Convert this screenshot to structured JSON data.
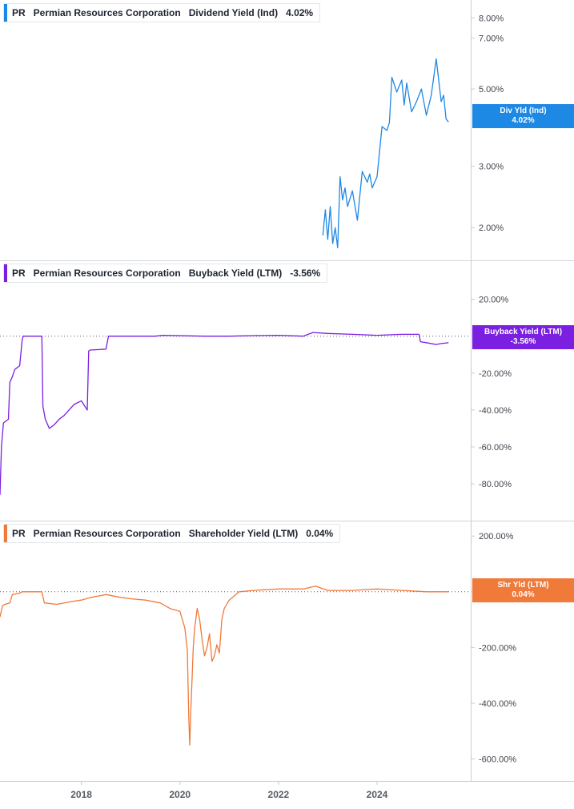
{
  "colors": {
    "dividend": "#1e88e5",
    "buyback": "#7b1fe0",
    "shareholder": "#f07a3a",
    "axis": "#c8ccd2",
    "text": "#40444c"
  },
  "x_axis": {
    "ticks": [
      "2018",
      "2020",
      "2022",
      "2024"
    ]
  },
  "chart_data": [
    {
      "type": "line",
      "ticker": "PR",
      "company": "Permian Resources Corporation",
      "metric": "Dividend Yield (Ind)",
      "current_value": "4.02%",
      "tag": {
        "line1": "Div Yld (Ind)",
        "line2": "4.02%"
      },
      "scale": "log",
      "y_ticks": [
        "8.00%",
        "7.00%",
        "5.00%",
        "3.00%",
        "2.00%"
      ],
      "y_tick_values": [
        8,
        7,
        5,
        3,
        2
      ],
      "series": [
        {
          "x": [
            2022.9,
            2022.95,
            2023.0,
            2023.05,
            2023.1,
            2023.15,
            2023.2,
            2023.25,
            2023.3,
            2023.35,
            2023.4,
            2023.5,
            2023.6,
            2023.7,
            2023.8,
            2023.85,
            2023.9,
            2024.0,
            2024.1,
            2024.2,
            2024.25,
            2024.3,
            2024.4,
            2024.5,
            2024.55,
            2024.6,
            2024.7,
            2024.8,
            2024.9,
            2025.0,
            2025.1,
            2025.2,
            2025.3,
            2025.35,
            2025.4,
            2025.45
          ],
          "y": [
            1.9,
            2.25,
            1.85,
            2.3,
            1.8,
            2.0,
            1.75,
            2.8,
            2.4,
            2.6,
            2.3,
            2.55,
            2.1,
            2.9,
            2.7,
            2.85,
            2.6,
            2.8,
            3.9,
            3.8,
            4.0,
            5.4,
            4.9,
            5.3,
            4.5,
            5.2,
            4.3,
            4.6,
            5.0,
            4.2,
            4.8,
            6.1,
            4.6,
            4.8,
            4.1,
            4.02
          ]
        }
      ]
    },
    {
      "type": "line",
      "ticker": "PR",
      "company": "Permian Resources Corporation",
      "metric": "Buyback Yield (LTM)",
      "current_value": "-3.56%",
      "tag": {
        "line1": "Buyback Yield (LTM)",
        "line2": "-3.56%"
      },
      "y_ticks": [
        "20.00%",
        "-20.00%",
        "-40.00%",
        "-60.00%",
        "-80.00%"
      ],
      "y_tick_values": [
        20,
        -20,
        -40,
        -60,
        -80
      ],
      "ylim": [
        -93,
        32
      ],
      "reference_line": 0,
      "series": [
        {
          "x": [
            2016.35,
            2016.38,
            2016.42,
            2016.52,
            2016.55,
            2016.6,
            2016.65,
            2016.75,
            2016.8,
            2016.82,
            2017.2,
            2017.22,
            2017.27,
            2017.35,
            2017.45,
            2017.55,
            2017.65,
            2017.75,
            2017.85,
            2018.0,
            2018.12,
            2018.15,
            2018.18,
            2018.5,
            2018.55,
            2019.5,
            2019.65,
            2020.5,
            2021.0,
            2021.5,
            2022.0,
            2022.5,
            2022.7,
            2023.0,
            2023.5,
            2024.0,
            2024.5,
            2024.85,
            2024.88,
            2025.0,
            2025.2,
            2025.3,
            2025.45
          ],
          "y": [
            -86,
            -60,
            -47,
            -45,
            -25,
            -22,
            -18,
            -16,
            -2,
            0,
            0,
            -38,
            -45,
            -50,
            -48,
            -45,
            -43,
            -40,
            -37,
            -35,
            -40,
            -8,
            -7.5,
            -7,
            0,
            0,
            0.5,
            0,
            0,
            0.3,
            0.5,
            0,
            2,
            1.5,
            1,
            0.5,
            1,
            1,
            -3,
            -3.5,
            -4.5,
            -4,
            -3.56
          ]
        }
      ]
    },
    {
      "type": "line",
      "ticker": "PR",
      "company": "Permian Resources Corporation",
      "metric": "Shareholder Yield (LTM)",
      "current_value": "0.04%",
      "tag": {
        "line1": "Shr Yld (LTM)",
        "line2": "0.04%"
      },
      "y_ticks": [
        "200.00%",
        "0.00%",
        "-200.00%",
        "-400.00%",
        "-600.00%"
      ],
      "y_tick_values": [
        200,
        0,
        -200,
        -400,
        -600
      ],
      "ylim": [
        -630,
        215
      ],
      "reference_line": 0,
      "series": [
        {
          "x": [
            2016.35,
            2016.4,
            2016.45,
            2016.55,
            2016.6,
            2016.75,
            2016.8,
            2017.2,
            2017.25,
            2017.5,
            2017.8,
            2018.0,
            2018.2,
            2018.5,
            2018.8,
            2019.0,
            2019.3,
            2019.6,
            2019.8,
            2020.0,
            2020.1,
            2020.15,
            2020.18,
            2020.2,
            2020.22,
            2020.25,
            2020.27,
            2020.3,
            2020.35,
            2020.4,
            2020.45,
            2020.5,
            2020.55,
            2020.6,
            2020.65,
            2020.7,
            2020.75,
            2020.8,
            2020.85,
            2020.9,
            2021.0,
            2021.2,
            2021.5,
            2022.0,
            2022.5,
            2022.75,
            2023.0,
            2023.5,
            2024.0,
            2024.5,
            2025.0,
            2025.45
          ],
          "y": [
            -90,
            -50,
            -45,
            -40,
            -10,
            -5,
            0,
            0,
            -40,
            -45,
            -35,
            -30,
            -20,
            -10,
            -20,
            -25,
            -30,
            -40,
            -60,
            -70,
            -130,
            -210,
            -450,
            -550,
            -430,
            -300,
            -200,
            -130,
            -60,
            -100,
            -170,
            -230,
            -200,
            -150,
            -250,
            -230,
            -190,
            -220,
            -100,
            -60,
            -30,
            0,
            5,
            10,
            10,
            20,
            5,
            5,
            10,
            5,
            0,
            0.04
          ]
        }
      ]
    }
  ]
}
